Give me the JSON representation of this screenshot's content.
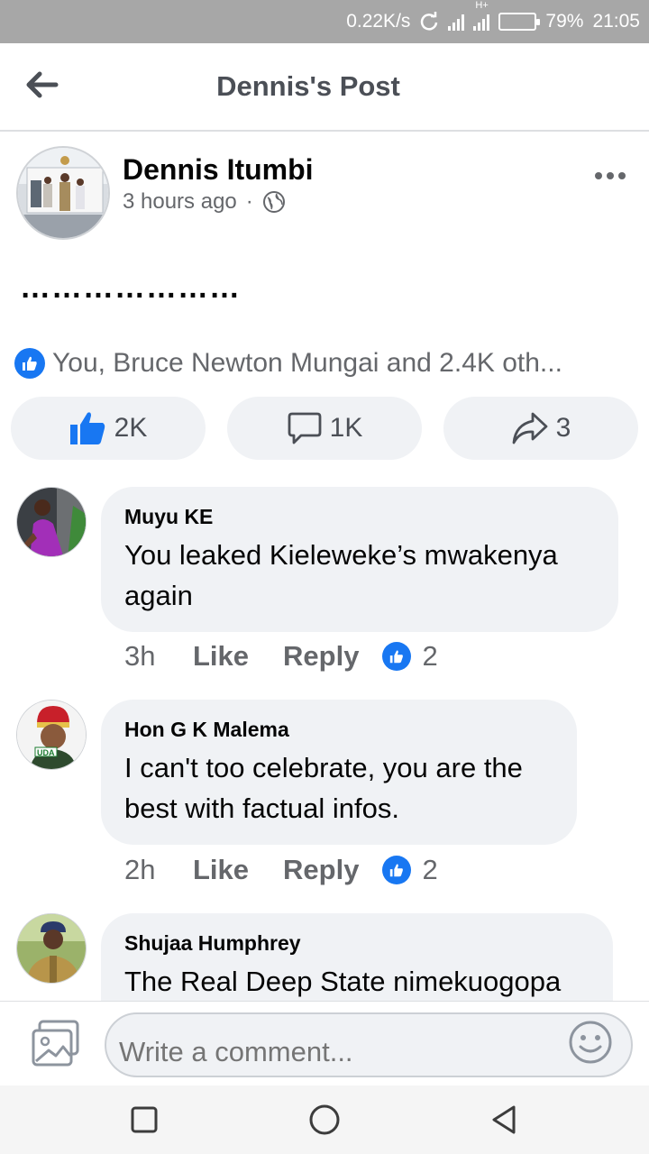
{
  "status_bar": {
    "speed": "0.22K/s",
    "network": "H+",
    "battery": "79%",
    "battery_level": 0.79,
    "time": "21:05"
  },
  "header": {
    "title": "Dennis's Post",
    "back_icon": "arrow-left-icon"
  },
  "post": {
    "author": "Dennis Itumbi",
    "time": "3 hours ago",
    "separator": "·",
    "privacy_icon": "globe-icon",
    "more_icon": "more-horizontal-icon",
    "text": "…………………",
    "reactions_summary": "You, Bruce Newton Mungai and 2.4K oth...",
    "actions": {
      "like_count": "2K",
      "comment_count": "1K",
      "share_count": "3"
    }
  },
  "comments": [
    {
      "author": "Muyu KE",
      "text": "You leaked Kieleweke’s mwakenya again",
      "time": "3h",
      "like_label": "Like",
      "reply_label": "Reply",
      "like_count": "2"
    },
    {
      "author": "Hon G K Malema",
      "avatar_badge": "UDA",
      "text": "I can't too celebrate, you are the best with factual infos.",
      "time": "2h",
      "like_label": "Like",
      "reply_label": "Reply",
      "like_count": "2"
    },
    {
      "author": "Shujaa Humphrey",
      "text": "The Real Deep State nimekuogopa"
    }
  ],
  "composer": {
    "placeholder": "Write a comment...",
    "photo_icon": "photo-icon",
    "emoji_icon": "emoji-icon"
  },
  "colors": {
    "accent": "#1877f2",
    "bubble": "#f0f2f5",
    "muted": "#65676b"
  }
}
